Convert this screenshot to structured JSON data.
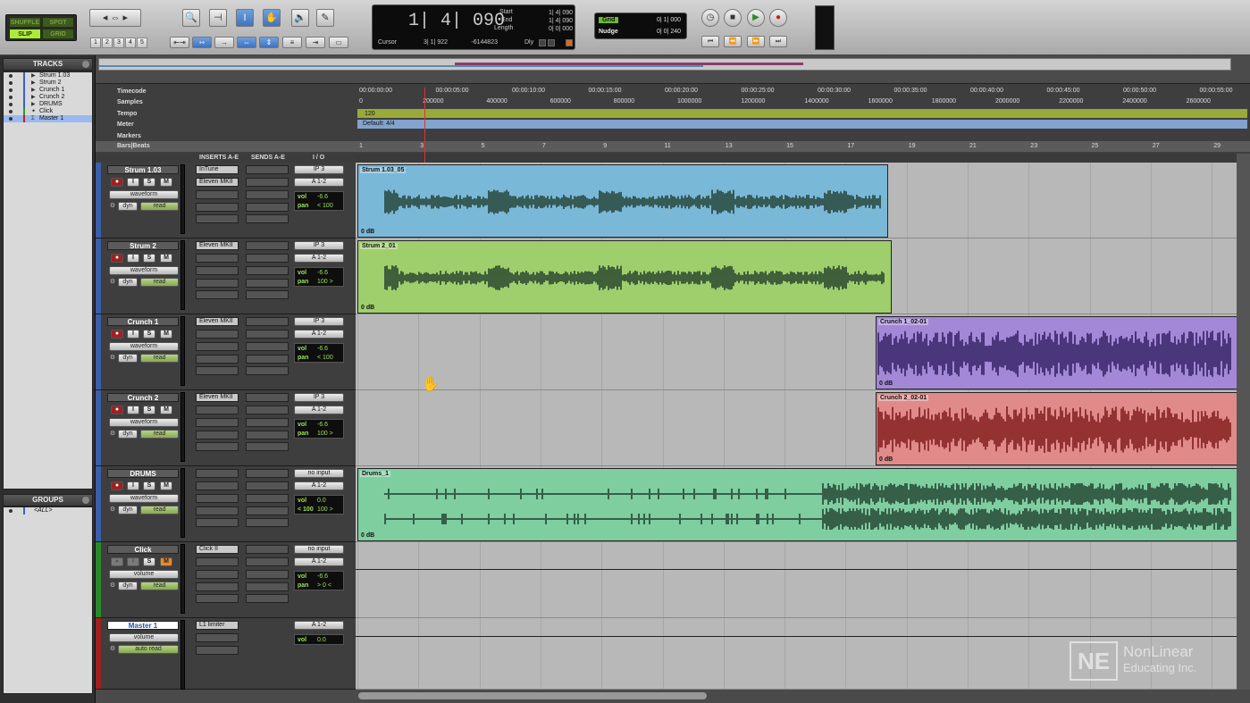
{
  "modes": {
    "shuffle": "SHUFFLE",
    "spot": "SPOT",
    "slip": "SLIP",
    "grid": "GRID"
  },
  "counter": {
    "main": "1| 4| 090",
    "start_label": "Start",
    "start_val": "1| 4| 090",
    "end_label": "End",
    "end_val": "1| 4| 090",
    "length_label": "Length",
    "length_val": "0| 0| 000",
    "cursor_label": "Cursor",
    "cursor_val": "3| 1| 922",
    "sample_val": "-6144823",
    "dly_label": "Dly"
  },
  "grid": {
    "grid_label": "Grid",
    "grid_val": "0| 1| 000",
    "nudge_label": "Nudge",
    "nudge_val": "0| 0| 240"
  },
  "zoom_presets": [
    "1",
    "2",
    "3",
    "4",
    "5"
  ],
  "panels": {
    "tracks_title": "TRACKS",
    "groups_title": "GROUPS",
    "all_group": "<ALL>"
  },
  "track_list": [
    "Strum 1.03",
    "Strum 2",
    "Crunch 1",
    "Crunch 2",
    "DRUMS",
    "Click",
    "Master 1"
  ],
  "rulers": {
    "timecode": "Timecode",
    "samples": "Samples",
    "tempo": "Tempo",
    "meter": "Meter",
    "markers": "Markers",
    "bars": "Bars|Beats",
    "tempo_val": "120",
    "meter_val": "Default: 4/4",
    "tc_ticks": [
      "00:00:00:00",
      "00:00:05:00",
      "00:00:10:00",
      "00:00:15:00",
      "00:00:20:00",
      "00:00:25:00",
      "00:00:30:00",
      "00:00:35:00",
      "00:00:40:00",
      "00:00:45:00",
      "00:00:50:00",
      "00:00:55:00"
    ],
    "sample_ticks": [
      "0",
      "200000",
      "400000",
      "600000",
      "800000",
      "1000000",
      "1200000",
      "1400000",
      "1600000",
      "1800000",
      "2000000",
      "2200000",
      "2400000",
      "2600000"
    ],
    "bar_ticks": [
      "1",
      "3",
      "5",
      "7",
      "9",
      "11",
      "13",
      "15",
      "17",
      "19",
      "21",
      "23",
      "25",
      "27",
      "29"
    ]
  },
  "columns": {
    "inserts": "INSERTS A-E",
    "sends": "SENDS A-E",
    "io": "I / O"
  },
  "buttons": {
    "i": "I",
    "s": "S",
    "m": "M"
  },
  "tracks": [
    {
      "name": "Strum 1.03",
      "view": "waveform",
      "dyn": "dyn",
      "auto": "read",
      "insert": "Eleven MKII",
      "insert0": "InTune",
      "input": "IP 3",
      "output": "A 1-2",
      "vol": "-6.6",
      "pan": "< 100",
      "clip": "Strum 1.03_05",
      "gain": "0 dB",
      "color": "#7ab8d8"
    },
    {
      "name": "Strum 2",
      "view": "waveform",
      "dyn": "dyn",
      "auto": "read",
      "insert": "Eleven MKII",
      "input": "IP 3",
      "output": "A 1-2",
      "vol": "-6.6",
      "pan": "100 >",
      "clip": "Strum 2_01",
      "gain": "0 dB",
      "color": "#9fcf6d"
    },
    {
      "name": "Crunch 1",
      "view": "waveform",
      "dyn": "dyn",
      "auto": "read",
      "insert": "Eleven MKII",
      "input": "IP 3",
      "output": "A 1-2",
      "vol": "-6.6",
      "pan": "< 100",
      "clip": "Crunch 1_02-01",
      "gain": "0 dB",
      "color": "#a488d8"
    },
    {
      "name": "Crunch 2",
      "view": "waveform",
      "dyn": "dyn",
      "auto": "read",
      "insert": "Eleven MKII",
      "input": "IP 3",
      "output": "A 1-2",
      "vol": "-6.6",
      "pan": "100 >",
      "clip": "Crunch 2_02-01",
      "gain": "0 dB",
      "color": "#e08a8a"
    },
    {
      "name": "DRUMS",
      "view": "waveform",
      "dyn": "dyn",
      "auto": "read",
      "input": "no input",
      "output": "A 1-2",
      "vol": "0.0",
      "pan": "< 100",
      "pan2": "100 >",
      "clip": "Drums_1",
      "gain": "0 dB",
      "color": "#7fcea0"
    },
    {
      "name": "Click",
      "view": "volume",
      "dyn": "dyn",
      "auto": "read",
      "insert": "Click II",
      "input": "no input",
      "output": "A 1-2",
      "vol": "-6.6",
      "pan": "> 0 <"
    },
    {
      "name": "Master 1",
      "view": "volume",
      "auto": "auto read",
      "insert": "L1 limiter",
      "output": "A 1-2",
      "vol": "0.0"
    }
  ],
  "vol_label": "vol",
  "pan_label": "pan",
  "watermark": {
    "logo": "NE",
    "line1": "NonLinear",
    "line2": "Educating Inc."
  }
}
